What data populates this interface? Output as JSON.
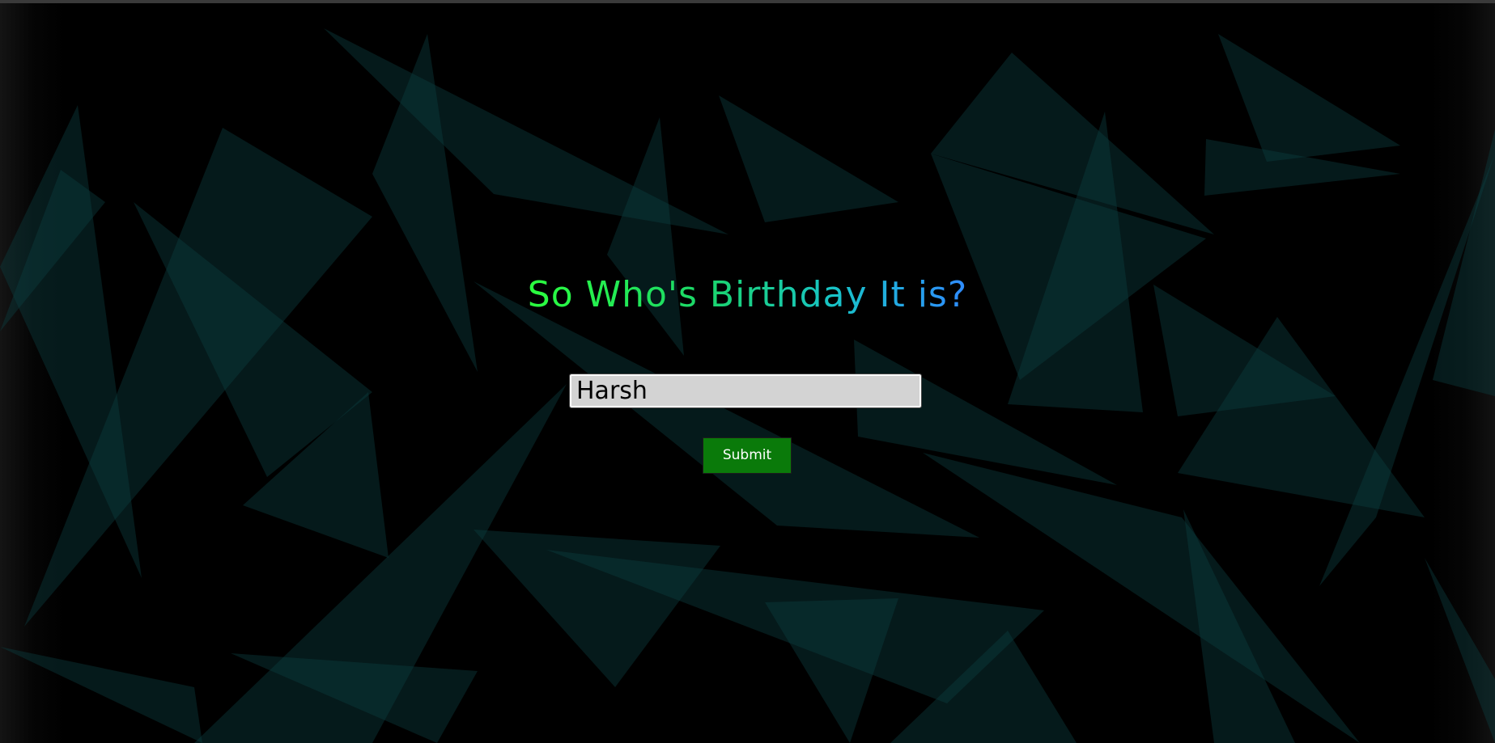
{
  "heading": {
    "text": "So Who's Birthday It is?"
  },
  "name_field": {
    "value": "Harsh"
  },
  "submit": {
    "label": "Submit"
  },
  "colors": {
    "background": "#000000",
    "shape": "#0b3e40",
    "heading_gradient_start": "#2bff3e",
    "heading_gradient_end": "#2f8bff",
    "input_background": "#d3d3d3",
    "button_background": "#0a7a0a"
  }
}
